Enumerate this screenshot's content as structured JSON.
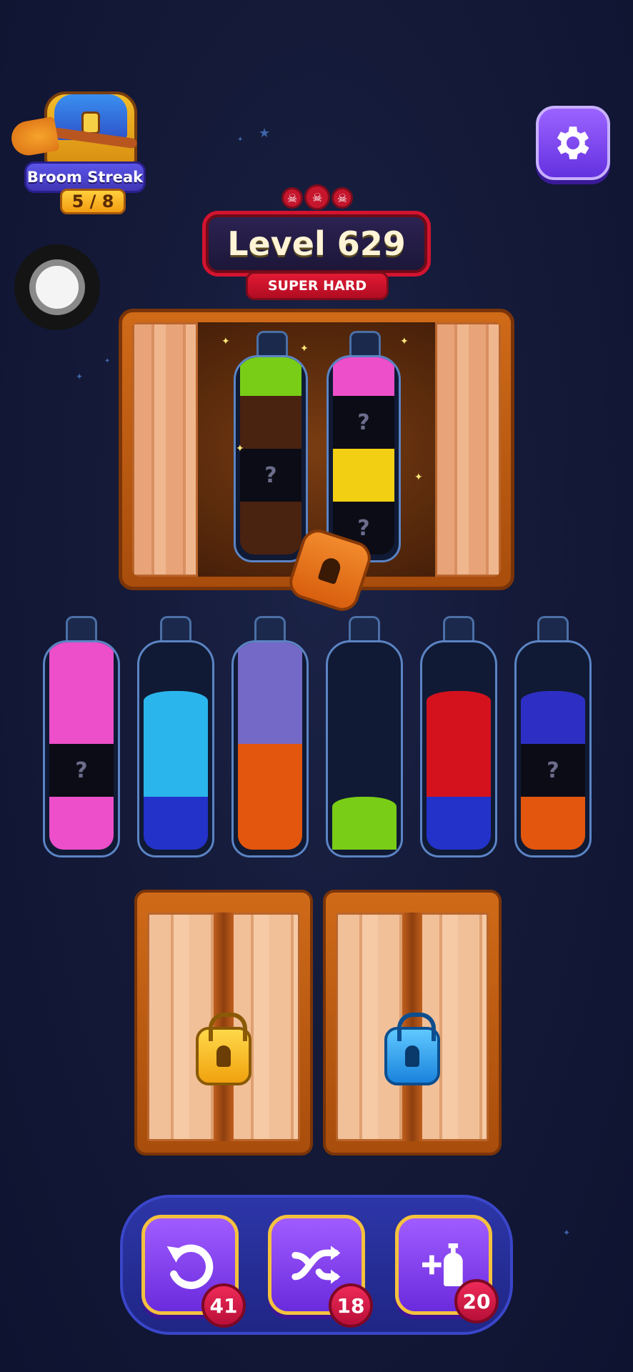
{
  "streak": {
    "label": "Broom Streak",
    "progress": "5 / 8"
  },
  "settings": {
    "icon": "gear-icon"
  },
  "level": {
    "title": "Level 629",
    "difficulty": "SUPER HARD",
    "skull_icons": [
      "skull-icon",
      "skull-icon",
      "skull-icon"
    ]
  },
  "colors": {
    "pink": "#ec4fc9",
    "cyan": "#2ab6ec",
    "blue": "#2332c8",
    "lavender": "#7569c7",
    "orange": "#e2560d",
    "green": "#79cd17",
    "red": "#d4121e",
    "indigo": "#2d2fc4",
    "hidden": "#0c0c16",
    "brown": "#4a2210",
    "yellow": "#f3cf13"
  },
  "locked_cabinet": {
    "bottles": [
      {
        "layers": [
          "brown",
          "hidden",
          "brown",
          "green"
        ],
        "hidden_mark": "?"
      },
      {
        "layers": [
          "hidden",
          "yellow",
          "hidden",
          "pink"
        ],
        "hidden_mark": "?"
      }
    ],
    "lock_icon": "padlock-icon"
  },
  "bottles": [
    {
      "layers": [
        "pink",
        "hidden",
        "pink",
        "pink"
      ],
      "hidden_mark": "?"
    },
    {
      "layers": [
        "blue",
        "cyan",
        "cyan"
      ],
      "hidden_mark": ""
    },
    {
      "layers": [
        "orange",
        "orange",
        "lavender",
        "lavender"
      ],
      "hidden_mark": ""
    },
    {
      "layers": [
        "green"
      ],
      "hidden_mark": ""
    },
    {
      "layers": [
        "blue",
        "red",
        "red"
      ],
      "hidden_mark": ""
    },
    {
      "layers": [
        "orange",
        "hidden",
        "indigo"
      ],
      "hidden_mark": "?"
    }
  ],
  "locked_slots": [
    {
      "lock_color": "yellow-padlock-icon"
    },
    {
      "lock_color": "blue-padlock-icon"
    }
  ],
  "tools": [
    {
      "name": "undo",
      "icon": "undo-icon",
      "count": "41"
    },
    {
      "name": "shuffle",
      "icon": "shuffle-icon",
      "count": "18"
    },
    {
      "name": "add-bottle",
      "icon": "add-bottle-icon",
      "count": "20"
    }
  ]
}
